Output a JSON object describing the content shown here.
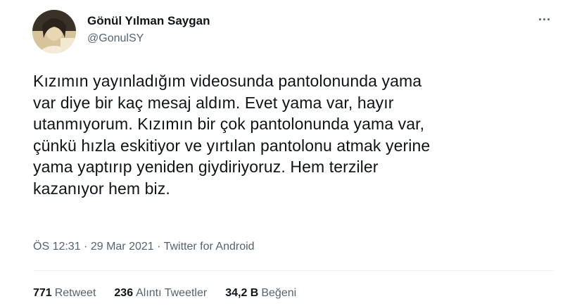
{
  "author": {
    "name": "Gönül Yılman Saygan",
    "handle": "@GonulSY"
  },
  "tweet": {
    "text": "Kızımın yayınladığım videosunda pantolonunda yama\nvar diye bir kaç mesaj aldım. Evet yama var, hayır\nutanmıyorum. Kızımın bir çok pantolonunda yama var,\nçünkü hızla eskitiyor ve yırtılan pantolonu atmak yerine\nyama yaptırıp yeniden giydiriyoruz. Hem terziler\nkazanıyor hem biz."
  },
  "meta": {
    "time": "ÖS 12:31",
    "date": "29 Mar 2021",
    "separator": " · ",
    "source": "Twitter for Android"
  },
  "stats": {
    "retweets_count": "771",
    "retweets_label": "Retweet",
    "quotes_count": "236",
    "quotes_label": "Alıntı Tweetler",
    "likes_count": "34,2 B",
    "likes_label": "Beğeni"
  },
  "icons": {
    "more": "more-options-icon"
  },
  "colors": {
    "text_primary": "#0f1419",
    "text_secondary": "#536471",
    "divider": "#eff3f4"
  }
}
